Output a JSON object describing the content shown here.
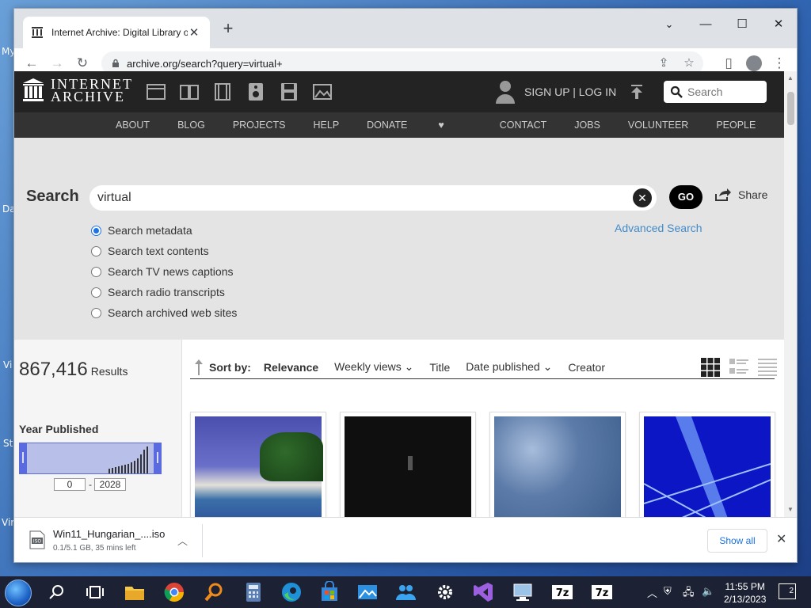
{
  "browser": {
    "tab_title": "Internet Archive: Digital Library o",
    "url": "archive.org/search?query=virtual+"
  },
  "ia": {
    "logo_line1": "INTERNET",
    "logo_line2": "ARCHIVE",
    "signin": "SIGN UP | LOG IN",
    "search_placeholder": "Search",
    "nav": [
      "ABOUT",
      "BLOG",
      "PROJECTS",
      "HELP",
      "DONATE",
      "CONTACT",
      "JOBS",
      "VOLUNTEER",
      "PEOPLE"
    ]
  },
  "search": {
    "label": "Search",
    "query": "virtual",
    "go_label": "GO",
    "share_label": "Share",
    "advanced_label": "Advanced Search",
    "options": [
      {
        "label": "Search metadata",
        "checked": true
      },
      {
        "label": "Search text contents",
        "checked": false
      },
      {
        "label": "Search TV news captions",
        "checked": false
      },
      {
        "label": "Search radio transcripts",
        "checked": false
      },
      {
        "label": "Search archived web sites",
        "checked": false
      }
    ]
  },
  "results": {
    "count": "867,416",
    "count_label": "Results",
    "year_title": "Year Published",
    "year_min": "0",
    "year_max": "2028",
    "sort_label": "Sort by:",
    "sort_options": [
      "Relevance",
      "Weekly views",
      "Title",
      "Date published",
      "Creator"
    ],
    "sort_active": "Relevance"
  },
  "download": {
    "filename": "Win11_Hungarian_....iso",
    "status": "0.1/5.1 GB, 35 mins left",
    "show_all": "Show all"
  },
  "taskbar": {
    "time": "11:55 PM",
    "date": "2/13/2023",
    "notifications": "2"
  },
  "desktop_labels": [
    "My",
    "Da",
    "Vi",
    "St",
    "Vir"
  ],
  "colors": {
    "ia_header": "#232323",
    "ia_nav": "#333333",
    "search_bg": "#e4e4e4",
    "link": "#428bca",
    "donate_heart": "#e5224c"
  }
}
